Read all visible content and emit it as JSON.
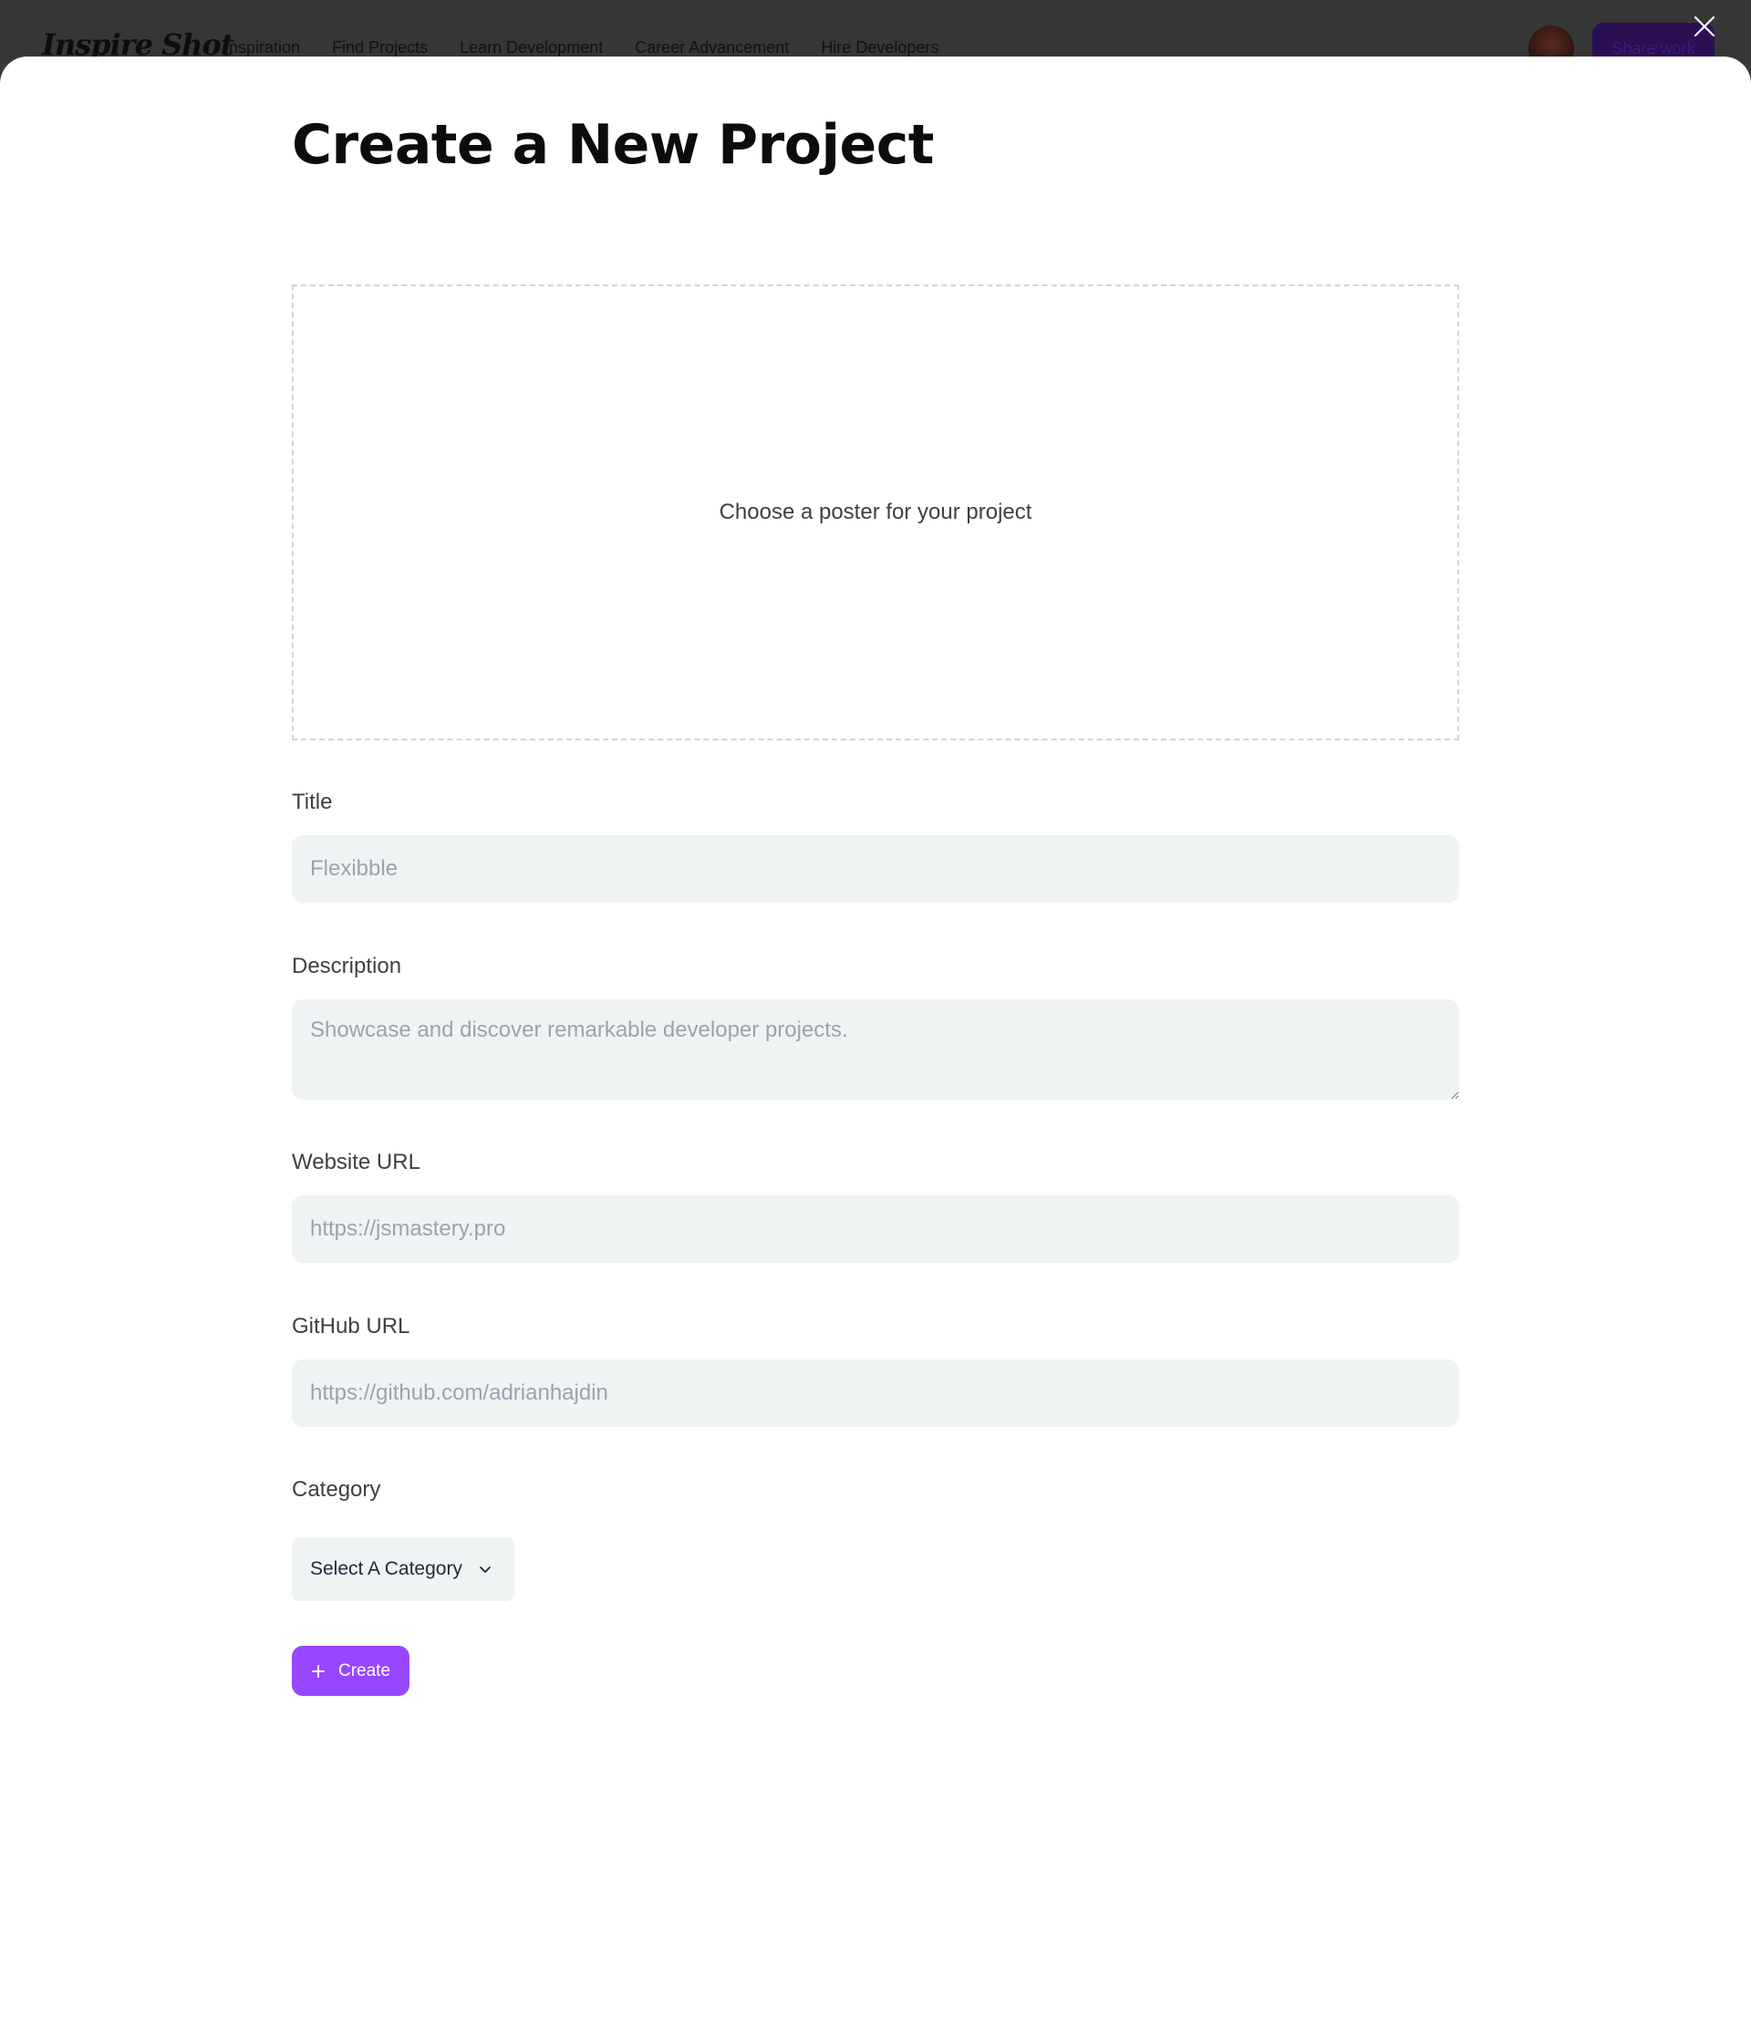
{
  "navbar": {
    "logo": "Inspire Shot",
    "links": [
      "Inspiration",
      "Find Projects",
      "Learn Development",
      "Career Advancement",
      "Hire Developers"
    ],
    "share_label": "Share work"
  },
  "modal": {
    "title": "Create a New Project",
    "poster_label": "Choose a poster for your project",
    "fields": {
      "title": {
        "label": "Title",
        "placeholder": "Flexibble",
        "value": ""
      },
      "description": {
        "label": "Description",
        "placeholder": "Showcase and discover remarkable developer projects.",
        "value": ""
      },
      "website": {
        "label": "Website URL",
        "placeholder": "https://jsmastery.pro",
        "value": ""
      },
      "github": {
        "label": "GitHub URL",
        "placeholder": "https://github.com/adrianhajdin",
        "value": ""
      }
    },
    "category": {
      "label": "Category",
      "selected": "Select A Category"
    },
    "create_label": "Create"
  },
  "colors": {
    "accent": "#9747ff",
    "input_bg": "#f0f3f4",
    "overlay": "#3a3a3a"
  },
  "icons": {
    "close": "close-icon",
    "chevron": "chevron-down-icon",
    "plus": "plus-icon"
  }
}
